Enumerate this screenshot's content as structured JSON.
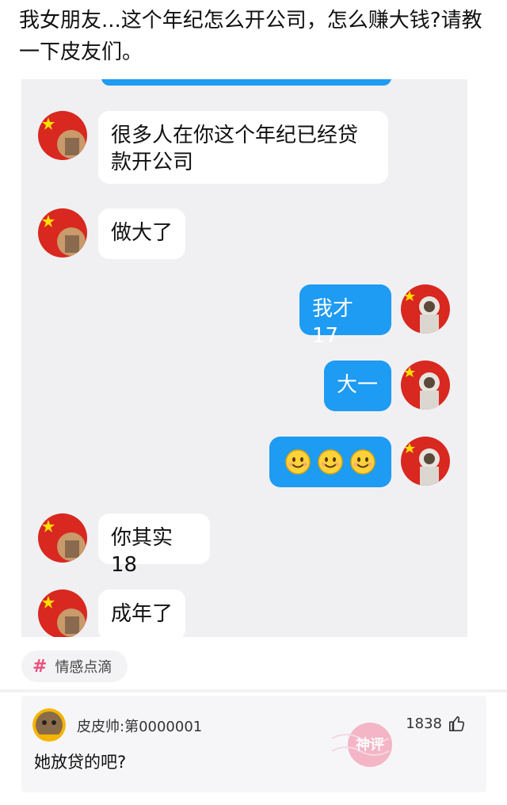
{
  "post": {
    "title": "我女朋友...这个年纪怎么开公司，怎么赚大钱?请教一下皮友们。"
  },
  "chat": {
    "messages": [
      {
        "side": "left",
        "text": "很多人在你这个年纪已经贷款开公司"
      },
      {
        "side": "left",
        "text": "做大了"
      },
      {
        "side": "right",
        "text": "我才17"
      },
      {
        "side": "right",
        "text": "大一"
      },
      {
        "side": "right",
        "text": "",
        "emoji": [
          "smile-emoji",
          "smile-emoji",
          "smile-emoji"
        ]
      },
      {
        "side": "left",
        "text": "你其实18"
      },
      {
        "side": "left",
        "text": "成年了"
      }
    ],
    "colors": {
      "right_bubble": "#1e9bf2",
      "left_bubble": "#ffffff",
      "background": "#f0f0f2"
    }
  },
  "tag": {
    "label": "情感点滴",
    "icon": "hash-icon",
    "color": "#e8507f"
  },
  "comment": {
    "username": "皮皮帅:第0000001",
    "text": "她放贷的吧?",
    "likes": "1838",
    "like_icon": "thumbs-up-icon",
    "stamp": "神评",
    "stamp_color": "#f06a8e"
  }
}
